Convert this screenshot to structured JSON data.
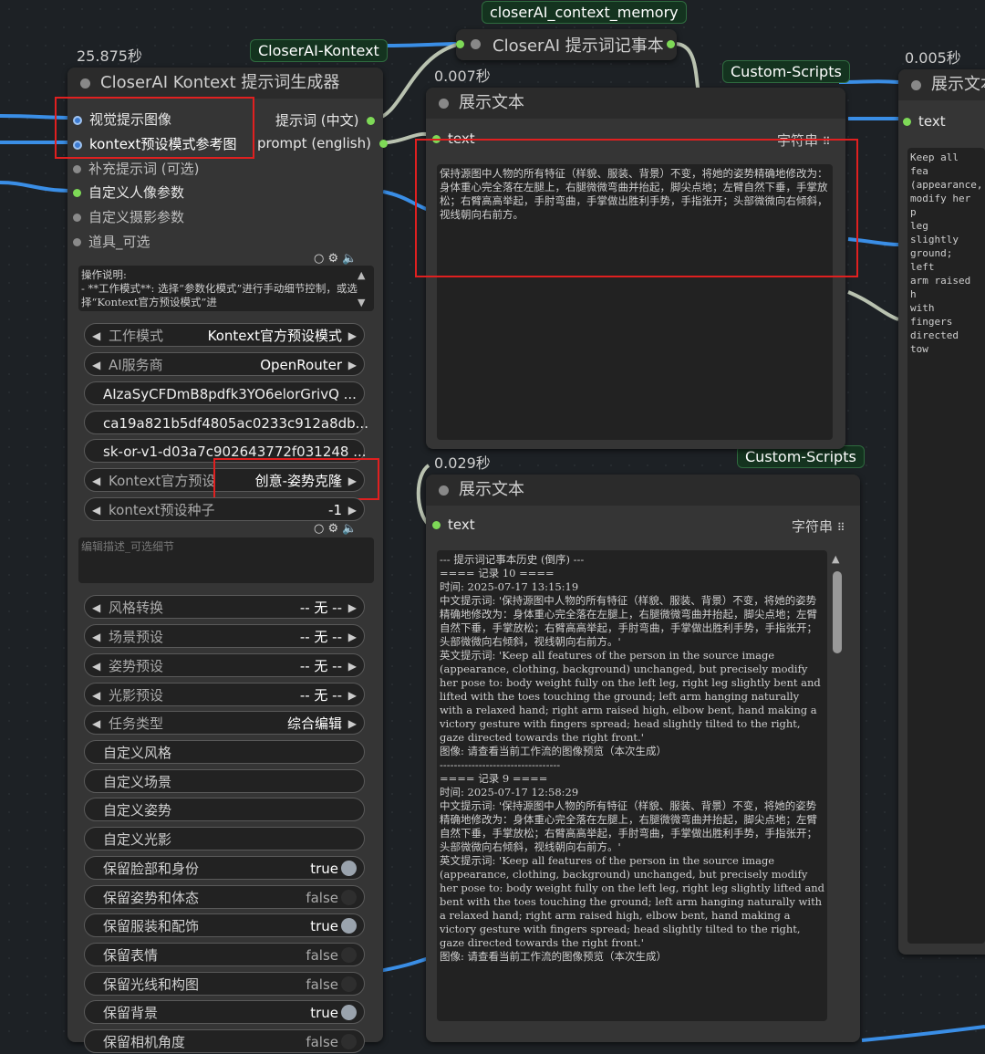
{
  "groups": {
    "context_memory": "closerAI_context_memory",
    "kontext": "CloserAI-Kontext",
    "custom_scripts_1": "Custom-Scripts",
    "custom_scripts_2": "Custom-Scripts"
  },
  "memory_node": {
    "title": "CloserAI 提示词记事本"
  },
  "generator": {
    "time": "25.875秒",
    "title": "CloserAI Kontext 提示词生成器",
    "inputs": [
      "视觉提示图像",
      "kontext预设模式参考图",
      "补充提示词 (可选)",
      "自定义人像参数",
      "自定义摄影参数",
      "道具_可选"
    ],
    "outputs": [
      "提示词 (中文)",
      "prompt (english)"
    ],
    "instructions": "操作说明:\n- **工作模式**: 选择“参数化模式”进行手动细节控制，或选择“Kontext官方预设模式”进",
    "combo_rows": [
      {
        "label": "工作模式",
        "value": "Kontext官方预设模式"
      },
      {
        "label": "AI服务商",
        "value": "OpenRouter"
      }
    ],
    "keys": [
      "AIzaSyCFDmB8pdfk3YO6elorGrivQ ...",
      "ca19a821b5df4805ac0233c912a8db...",
      "sk-or-v1-d03a7c902643772f031248 ..."
    ],
    "preset": {
      "label": "Kontext官方预设",
      "value": "创意-姿势克隆"
    },
    "seed": {
      "label": "kontext预设种子",
      "value": "-1"
    },
    "edit_placeholder": "编辑描述_可选细节",
    "presets": [
      {
        "label": "风格转换",
        "value": "-- 无 --"
      },
      {
        "label": "场景预设",
        "value": "-- 无 --"
      },
      {
        "label": "姿势预设",
        "value": "-- 无 --"
      },
      {
        "label": "光影预设",
        "value": "-- 无 --"
      },
      {
        "label": "任务类型",
        "value": "综合编辑"
      }
    ],
    "customs": [
      "自定义风格",
      "自定义场景",
      "自定义姿势",
      "自定义光影"
    ],
    "toggles": [
      {
        "label": "保留脸部和身份",
        "value": "true"
      },
      {
        "label": "保留姿势和体态",
        "value": "false"
      },
      {
        "label": "保留服装和配饰",
        "value": "true"
      },
      {
        "label": "保留表情",
        "value": "false"
      },
      {
        "label": "保留光线和构图",
        "value": "false"
      },
      {
        "label": "保留背景",
        "value": "true"
      },
      {
        "label": "保留相机角度",
        "value": "false"
      }
    ]
  },
  "show_text_1": {
    "time": "0.007秒",
    "title": "展示文本",
    "input": "text",
    "type": "字符串",
    "content": "保持源图中人物的所有特征（样貌、服装、背景）不变，将她的姿势精确地修改为：身体重心完全落在左腿上，右腿微微弯曲并抬起，脚尖点地；左臂自然下垂，手掌放松；右臂高高举起，手肘弯曲，手掌做出胜利手势，手指张开；头部微微向右倾斜，视线朝向右前方。"
  },
  "show_text_2": {
    "time": "0.029秒",
    "title": "展示文本",
    "input": "text",
    "type": "字符串",
    "content": "--- 提示词记事本历史 (倒序) ---\n==== 记录 10 ====\n时间: 2025-07-17 13:15:19\n中文提示词: '保持源图中人物的所有特征（样貌、服装、背景）不变，将她的姿势精确地修改为：身体重心完全落在左腿上，右腿微微弯曲并抬起，脚尖点地；左臂自然下垂，手掌放松；右臂高高举起，手肘弯曲，手掌做出胜利手势，手指张开；头部微微向右倾斜，视线朝向右前方。'\n英文提示词: 'Keep all features of the person in the source image (appearance, clothing, background) unchanged, but precisely modify her pose to: body weight fully on the left leg, right leg slightly bent and lifted with the toes touching the ground; left arm hanging naturally with a relaxed hand; right arm raised high, elbow bent, hand making a victory gesture with fingers spread; head slightly tilted to the right, gaze directed towards the right front.'\n图像: 请查看当前工作流的图像预览（本次生成）\n----------------------------------\n==== 记录 9 ====\n时间: 2025-07-17 12:58:29\n中文提示词: '保持源图中人物的所有特征（样貌、服装、背景）不变，将她的姿势精确地修改为：身体重心完全落在左腿上，右腿微微弯曲并抬起，脚尖点地；左臂自然下垂，手掌放松；右臂高高举起，手肘弯曲，手掌做出胜利手势，手指张开；头部微微向右倾斜，视线朝向右前方。'\n英文提示词: 'Keep all features of the person in the source image (appearance, clothing, background) unchanged, but precisely modify her pose to: body weight fully on the left leg, right leg slightly lifted and bent with the toes touching the ground; left arm hanging naturally with a relaxed hand; right arm raised high, elbow bent, hand making a victory gesture with fingers spread; head slightly tilted to the right, gaze directed towards the right front.'\n图像: 请查看当前工作流的图像预览（本次生成）"
  },
  "show_text_3": {
    "time": "0.005秒",
    "title": "展示文本",
    "input": "text",
    "content": "Keep all fea\n(appearance,\nmodify her p\nleg slightly\nground; left\narm raised h\nwith fingers\ndirected tow"
  },
  "colors": {
    "wire_blue": "#3a8ee6",
    "wire_grey": "#b9c2b0",
    "highlight": "#e02020",
    "socket_green": "#7ed957"
  }
}
